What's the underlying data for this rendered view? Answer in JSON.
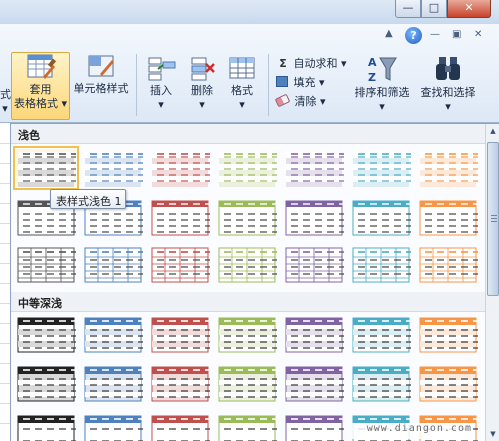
{
  "window": {
    "min_glyph": "—",
    "max_glyph": "□",
    "close_glyph": "✕"
  },
  "ribbon": {
    "help_glyph": "?",
    "left_cut_label_1": "式",
    "left_cut_label_2": "▾",
    "buttons": {
      "table_format": {
        "line1": "套用",
        "line2": "表格格式 ▾"
      },
      "cell_styles": {
        "label": "单元格样式"
      },
      "insert": {
        "label": "插入"
      },
      "delete": {
        "label": "删除"
      },
      "format": {
        "label": "格式"
      },
      "sort_filter": {
        "label": "排序和筛选"
      },
      "find_select": {
        "label": "查找和选择"
      }
    },
    "editing": {
      "autosum": {
        "glyph": "Σ",
        "label": "自动求和 ▾"
      },
      "fill": {
        "label": "填充 ▾"
      },
      "clear": {
        "label": "清除 ▾"
      }
    }
  },
  "gallery": {
    "sections": [
      {
        "title": "浅色"
      },
      {
        "title": "中等深浅"
      }
    ],
    "tooltip": "表样式浅色 1",
    "light_colors": [
      "#555555",
      "#4f81bd",
      "#c0504d",
      "#9bbb59",
      "#8064a2",
      "#4bacc6",
      "#f79646"
    ],
    "medium_colors": [
      "#222222",
      "#4f81bd",
      "#c0504d",
      "#9bbb59",
      "#8064a2",
      "#4bacc6",
      "#f79646"
    ],
    "tints": [
      "#d9d9d9",
      "#dbe5f1",
      "#f2dcdb",
      "#ebf1de",
      "#e5e0ec",
      "#daeef3",
      "#fde9d9"
    ]
  },
  "watermark": "www.diangon.com"
}
